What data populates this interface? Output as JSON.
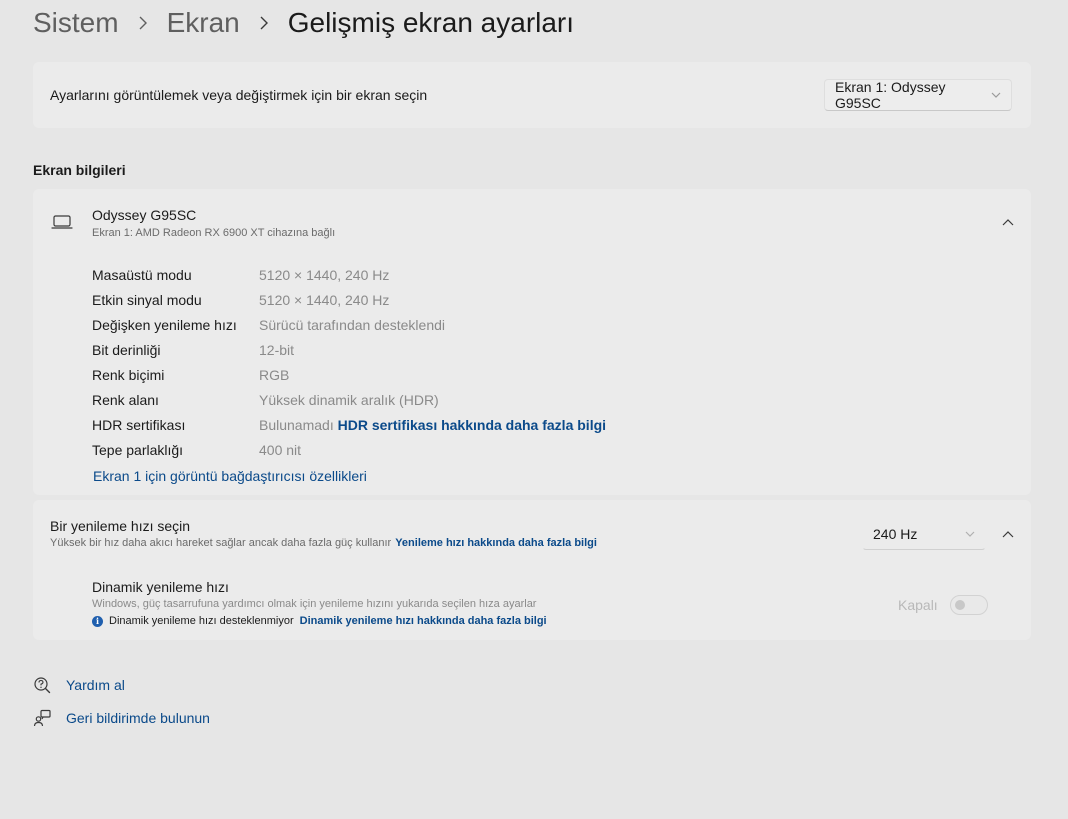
{
  "breadcrumb": {
    "items": [
      "Sistem",
      "Ekran"
    ],
    "current": "Gelişmiş ekran ayarları"
  },
  "display_select": {
    "label": "Ayarlarını görüntülemek veya değiştirmek için bir ekran seçin",
    "selected": "Ekran 1: Odyssey G95SC"
  },
  "display_info": {
    "section_title": "Ekran bilgileri",
    "monitor_name": "Odyssey G95SC",
    "monitor_sub": "Ekran 1: AMD Radeon RX 6900 XT cihazına bağlı",
    "rows": [
      {
        "key": "Masaüstü modu",
        "value": "5120 × 1440, 240 Hz"
      },
      {
        "key": "Etkin sinyal modu",
        "value": "5120 × 1440, 240 Hz"
      },
      {
        "key": "Değişken yenileme hızı",
        "value": "Sürücü tarafından desteklendi"
      },
      {
        "key": "Bit derinliği",
        "value": "12-bit"
      },
      {
        "key": "Renk biçimi",
        "value": "RGB"
      },
      {
        "key": "Renk alanı",
        "value": "Yüksek dinamik aralık (HDR)"
      },
      {
        "key": "HDR sertifikası",
        "value": "Bulunamadı",
        "link": "HDR sertifikası hakkında daha fazla bilgi"
      },
      {
        "key": "Tepe parlaklığı",
        "value": "400 nit"
      }
    ],
    "adapter_link": "Ekran 1 için görüntü bağdaştırıcısı özellikleri"
  },
  "refresh": {
    "title": "Bir yenileme hızı seçin",
    "subtitle": "Yüksek bir hız daha akıcı hareket sağlar ancak daha fazla güç kullanır",
    "subtitle_link": "Yenileme hızı hakkında daha fazla bilgi",
    "selected": "240 Hz",
    "dynamic": {
      "title": "Dinamik yenileme hızı",
      "subtitle": "Windows, güç tasarrufuna yardımcı olmak için yenileme hızını yukarıda seçilen hıza ayarlar",
      "note": "Dinamik yenileme hızı desteklenmiyor",
      "note_link": "Dinamik yenileme hızı hakkında daha fazla bilgi",
      "toggle_label": "Kapalı",
      "toggle_on": false
    }
  },
  "footer": {
    "help": "Yardım al",
    "feedback": "Geri bildirimde bulunun"
  },
  "icons": {
    "monitor": "monitor-icon",
    "chevron_up": "chevron-up-icon",
    "chevron_down": "chevron-down-icon",
    "info": "info-icon",
    "help": "help-icon",
    "feedback": "feedback-icon"
  },
  "colors": {
    "background": "#e6e6e6",
    "card": "#ebebeb",
    "link": "#0b4a8a",
    "text": "#1b1b1b",
    "secondary": "#8a8a8a"
  }
}
